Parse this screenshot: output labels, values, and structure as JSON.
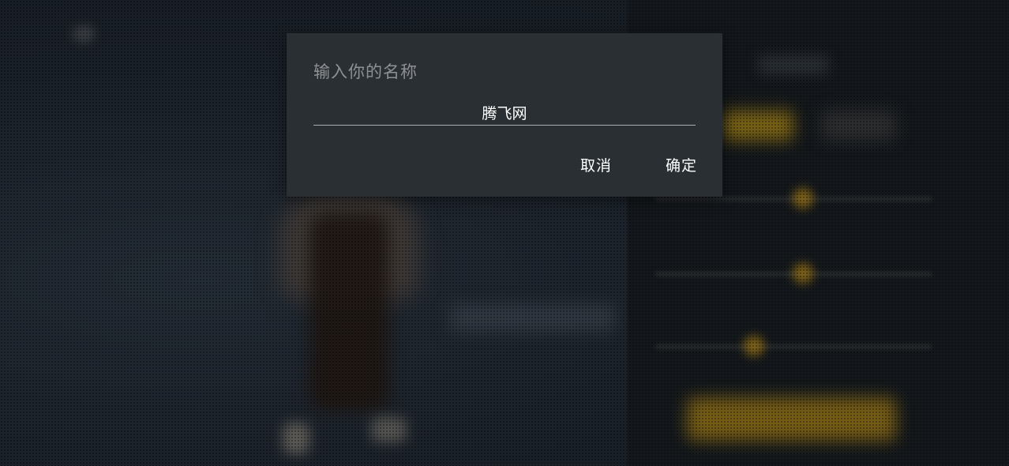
{
  "dialog": {
    "title": "输入你的名称",
    "name_value": "腾飞网",
    "cancel_label": "取消",
    "ok_label": "确定"
  },
  "colors": {
    "dialog_bg": "#2a2f33",
    "title_text": "#8e9194",
    "button_text": "#ffffff",
    "accent_gold": "#a07a14"
  }
}
